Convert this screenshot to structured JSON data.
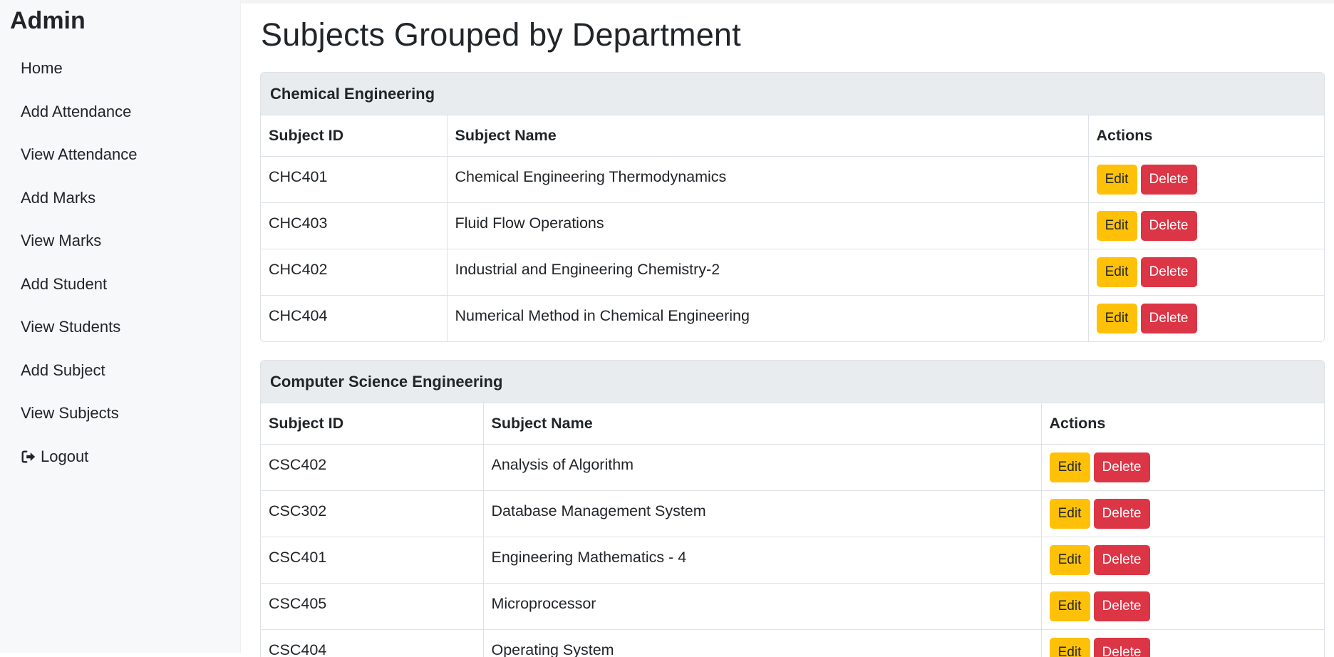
{
  "sidebar": {
    "brand": "Admin",
    "items": [
      {
        "label": "Home",
        "icon": ""
      },
      {
        "label": "Add Attendance",
        "icon": ""
      },
      {
        "label": "View Attendance",
        "icon": ""
      },
      {
        "label": "Add Marks",
        "icon": ""
      },
      {
        "label": "View Marks",
        "icon": ""
      },
      {
        "label": "Add Student",
        "icon": ""
      },
      {
        "label": "View Students",
        "icon": ""
      },
      {
        "label": "Add Subject",
        "icon": ""
      },
      {
        "label": "View Subjects",
        "icon": ""
      },
      {
        "label": "Logout",
        "icon": "logout-icon"
      }
    ]
  },
  "main": {
    "title": "Subjects Grouped by Department",
    "departments": [
      {
        "name": "Chemical Engineering",
        "columns": [
          "Subject ID",
          "Subject Name",
          "Actions"
        ],
        "rows": [
          {
            "id": "CHC401",
            "name": "Chemical Engineering Thermodynamics"
          },
          {
            "id": "CHC403",
            "name": "Fluid Flow Operations"
          },
          {
            "id": "CHC402",
            "name": "Industrial and Engineering Chemistry-2"
          },
          {
            "id": "CHC404",
            "name": "Numerical Method in Chemical Engineering"
          }
        ]
      },
      {
        "name": "Computer Science Engineering",
        "columns": [
          "Subject ID",
          "Subject Name",
          "Actions"
        ],
        "rows": [
          {
            "id": "CSC402",
            "name": "Analysis of Algorithm"
          },
          {
            "id": "CSC302",
            "name": "Database Management System"
          },
          {
            "id": "CSC401",
            "name": "Engineering Mathematics - 4"
          },
          {
            "id": "CSC405",
            "name": "Microprocessor"
          },
          {
            "id": "CSC404",
            "name": "Operating System"
          }
        ]
      }
    ],
    "actions": {
      "edit_label": "Edit",
      "delete_label": "Delete"
    }
  },
  "colors": {
    "edit_button": "#ffc107",
    "delete_button": "#dc3545",
    "card_header": "#e9ecef",
    "sidebar_bg": "#f7f8fa"
  }
}
